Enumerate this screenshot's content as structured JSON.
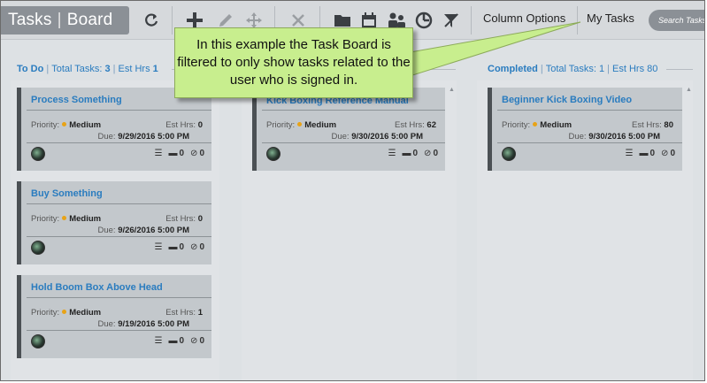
{
  "toolbar": {
    "title_left": "Tasks",
    "title_sep": "|",
    "title_right": "Board",
    "column_options_label": "Column Options",
    "my_tasks_label": "My Tasks",
    "search_placeholder": "Search Tasks"
  },
  "columns": [
    {
      "name": "To Do",
      "total_label": "Total Tasks:",
      "total_value": "3",
      "est_label": "Est Hrs",
      "est_value": "1",
      "cards": [
        {
          "title": "Process Something",
          "priority_label": "Priority:",
          "priority": "Medium",
          "est_label": "Est Hrs:",
          "est_hrs": "0",
          "due_label": "Due:",
          "due": "9/29/2016 5:00 PM",
          "subtasks": "",
          "comments": "0",
          "attachments": "0"
        },
        {
          "title": "Buy Something",
          "priority_label": "Priority:",
          "priority": "Medium",
          "est_label": "Est Hrs:",
          "est_hrs": "0",
          "due_label": "Due:",
          "due": "9/26/2016 5:00 PM",
          "subtasks": "",
          "comments": "0",
          "attachments": "0"
        },
        {
          "title": "Hold Boom Box Above Head",
          "priority_label": "Priority:",
          "priority": "Medium",
          "est_label": "Est Hrs:",
          "est_hrs": "1",
          "due_label": "Due:",
          "due": "9/19/2016 5:00 PM",
          "subtasks": "",
          "comments": "0",
          "attachments": "0"
        }
      ]
    },
    {
      "name": "",
      "cards": [
        {
          "title": "Kick Boxing Reference Manual",
          "priority_label": "Priority:",
          "priority": "Medium",
          "est_label": "Est Hrs:",
          "est_hrs": "62",
          "due_label": "Due:",
          "due": "9/30/2016 5:00 PM",
          "subtasks": "",
          "comments": "0",
          "attachments": "0"
        }
      ]
    },
    {
      "name": "Completed",
      "total_label": "Total Tasks:",
      "total_value": "1",
      "est_label": "Est Hrs",
      "est_value": "80",
      "cards": [
        {
          "title": "Beginner Kick Boxing Video",
          "priority_label": "Priority:",
          "priority": "Medium",
          "est_label": "Est Hrs:",
          "est_hrs": "80",
          "due_label": "Due:",
          "due": "9/30/2016 5:00 PM",
          "subtasks": "",
          "comments": "0",
          "attachments": "0"
        }
      ]
    }
  ],
  "callout": {
    "text": "In this example the Task Board is filtered to only show tasks related to the user who is signed in."
  },
  "colors": {
    "accent_blue": "#2a7cbf",
    "priority_medium": "#e8a317",
    "callout_green": "#c8ee8e",
    "card_border": "#4b5054"
  },
  "icons": [
    "refresh-icon",
    "add-icon",
    "edit-icon",
    "move-icon",
    "delete-icon",
    "folder-icon",
    "calendar-icon",
    "users-icon",
    "report-icon",
    "clear-filter-icon",
    "subtasks-icon",
    "comment-icon",
    "attachment-icon"
  ]
}
